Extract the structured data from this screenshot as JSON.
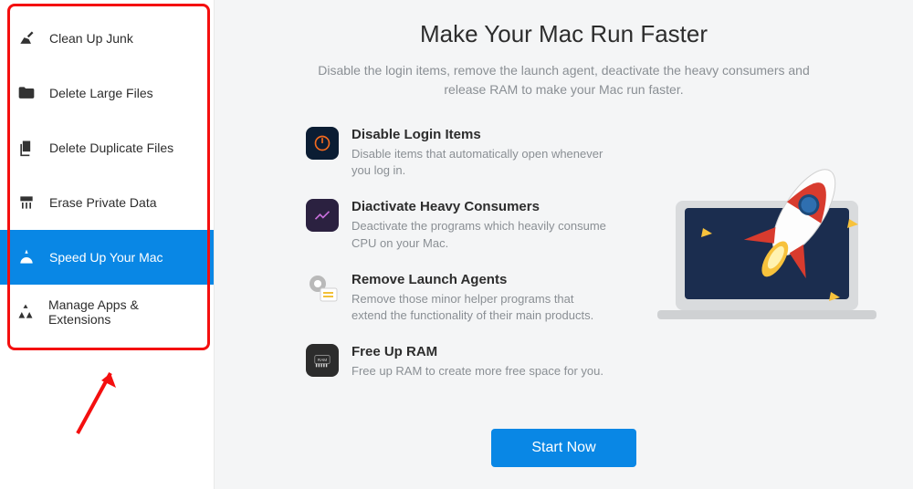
{
  "sidebar": {
    "items": [
      {
        "label": "Clean Up Junk",
        "icon": "broom-icon"
      },
      {
        "label": "Delete Large Files",
        "icon": "folder-icon"
      },
      {
        "label": "Delete Duplicate Files",
        "icon": "duplicate-icon"
      },
      {
        "label": "Erase Private Data",
        "icon": "shredder-icon"
      },
      {
        "label": "Speed Up Your Mac",
        "icon": "speed-icon"
      },
      {
        "label": "Manage Apps & Extensions",
        "icon": "apps-icon"
      }
    ],
    "active_index": 4
  },
  "main": {
    "title": "Make Your Mac Run Faster",
    "subtitle": "Disable the login items, remove the launch agent, deactivate the heavy consumers and release RAM to make your Mac run faster.",
    "features": [
      {
        "title": "Disable Login Items",
        "desc": "Disable items that automatically open whenever you log in."
      },
      {
        "title": "Diactivate Heavy Consumers",
        "desc": "Deactivate the programs which heavily consume CPU on your Mac."
      },
      {
        "title": "Remove Launch Agents",
        "desc": "Remove those minor helper programs that extend the functionality of their main products."
      },
      {
        "title": "Free Up RAM",
        "desc": "Free up RAM to create more free space for you."
      }
    ],
    "start_button": "Start Now"
  },
  "colors": {
    "accent": "#0987e5",
    "highlight": "#f40f0f"
  }
}
